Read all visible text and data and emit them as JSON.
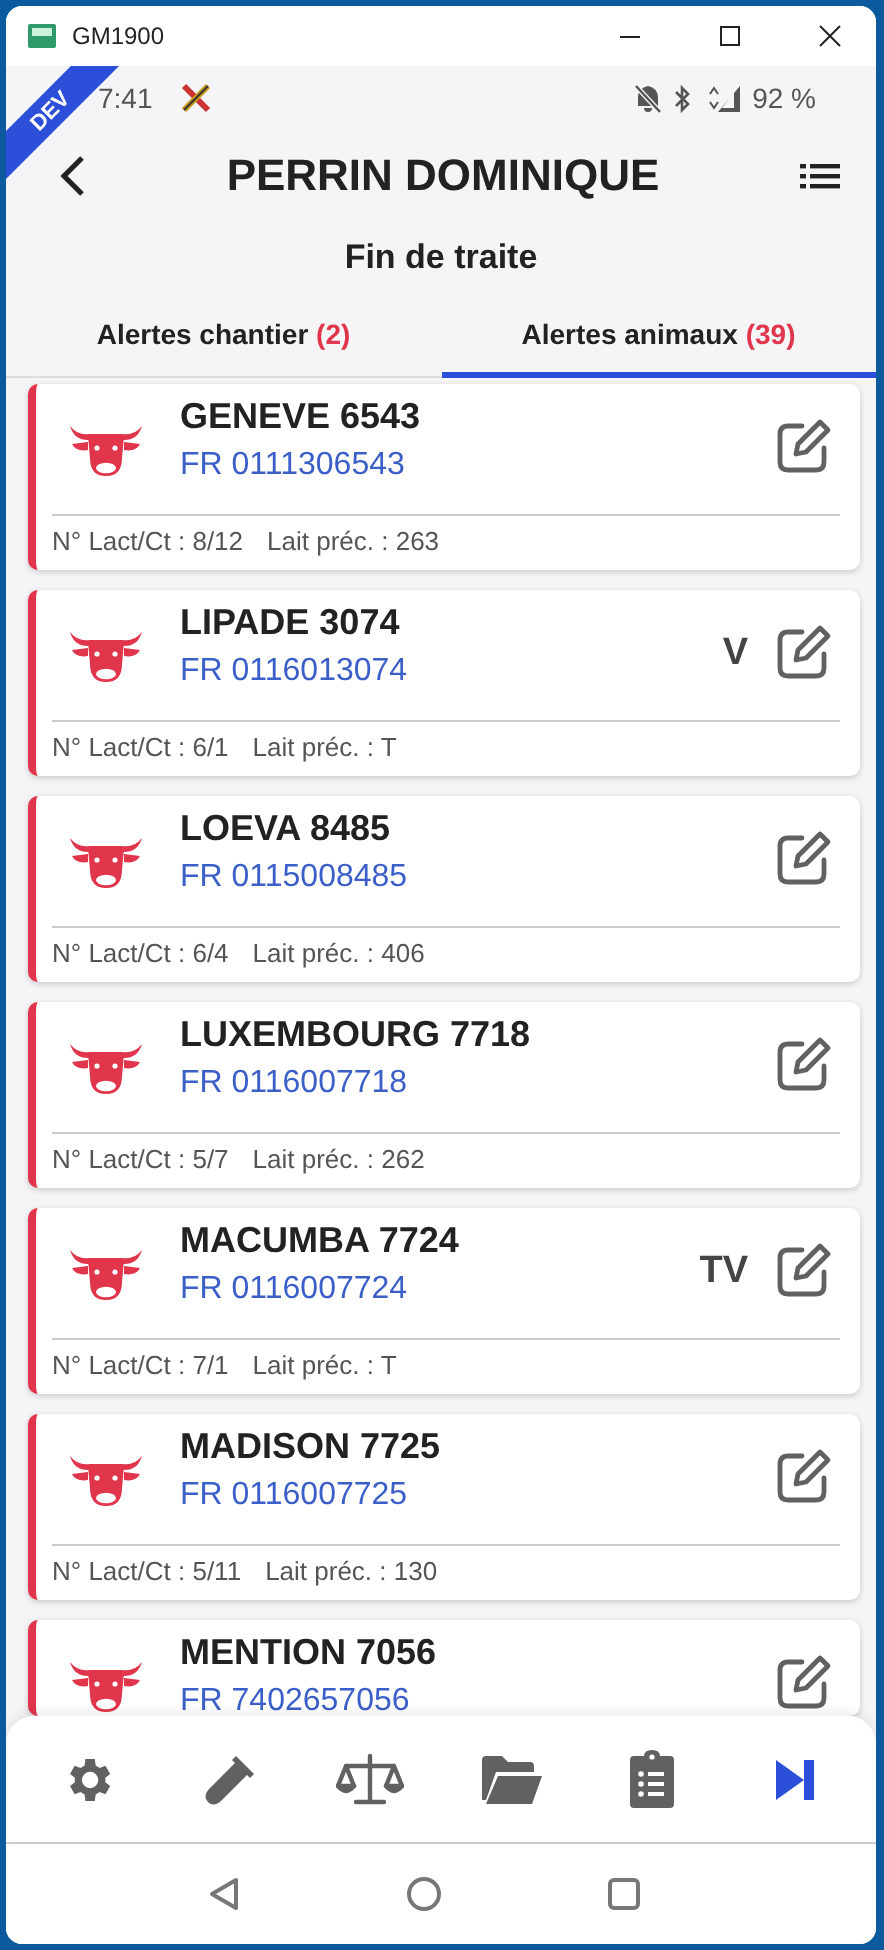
{
  "window": {
    "title": "GM1900"
  },
  "ribbon": "DEV",
  "status_bar": {
    "time": "7:41",
    "battery": "92 %"
  },
  "header": {
    "title": "PERRIN DOMINIQUE",
    "subtitle": "Fin de traite"
  },
  "tabs": [
    {
      "label": "Alertes chantier",
      "count": "(2)",
      "selected": false
    },
    {
      "label": "Alertes animaux",
      "count": "(39)",
      "selected": true
    }
  ],
  "animals": [
    {
      "name": "GENEVE 6543",
      "id": "FR 0111306543",
      "lactation": "N° Lact/Ct : 8/12",
      "previous_milk": "Lait préc. : 263"
    },
    {
      "name": "LIPADE 3074",
      "id": "FR 0116013074",
      "flag": "V",
      "lactation": "N° Lact/Ct : 6/1",
      "previous_milk": "Lait préc. : T"
    },
    {
      "name": "LOEVA 8485",
      "id": "FR 0115008485",
      "lactation": "N° Lact/Ct : 6/4",
      "previous_milk": "Lait préc. : 406"
    },
    {
      "name": "LUXEMBOURG 7718",
      "id": "FR 0116007718",
      "lactation": "N° Lact/Ct : 5/7",
      "previous_milk": "Lait préc. : 262"
    },
    {
      "name": "MACUMBA 7724",
      "id": "FR 0116007724",
      "flag": "TV",
      "lactation": "N° Lact/Ct : 7/1",
      "previous_milk": "Lait préc. : T"
    },
    {
      "name": "MADISON 7725",
      "id": "FR 0116007725",
      "lactation": "N° Lact/Ct : 5/11",
      "previous_milk": "Lait préc. : 130"
    },
    {
      "name": "MENTION 7056",
      "id": "FR 7402657056"
    }
  ],
  "bottom_nav": [
    {
      "kind": "settings",
      "selected": false
    },
    {
      "kind": "tube",
      "selected": false
    },
    {
      "kind": "scale",
      "selected": false
    },
    {
      "kind": "folder",
      "selected": false
    },
    {
      "kind": "clipboard",
      "selected": false
    },
    {
      "kind": "next",
      "selected": true
    }
  ]
}
